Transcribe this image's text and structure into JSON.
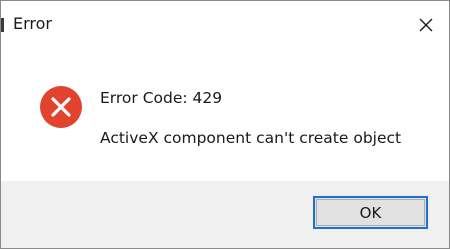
{
  "window": {
    "title": "Error",
    "close_icon": "close-icon"
  },
  "message": {
    "icon": "error-icon",
    "code_line": "Error Code: 429",
    "text_line": "ActiveX component can't create object"
  },
  "buttons": {
    "ok_label": "OK"
  },
  "colors": {
    "error_red": "#e2432f",
    "accent_border": "#1d6fd1",
    "footer_bg": "#f0f0f0"
  }
}
